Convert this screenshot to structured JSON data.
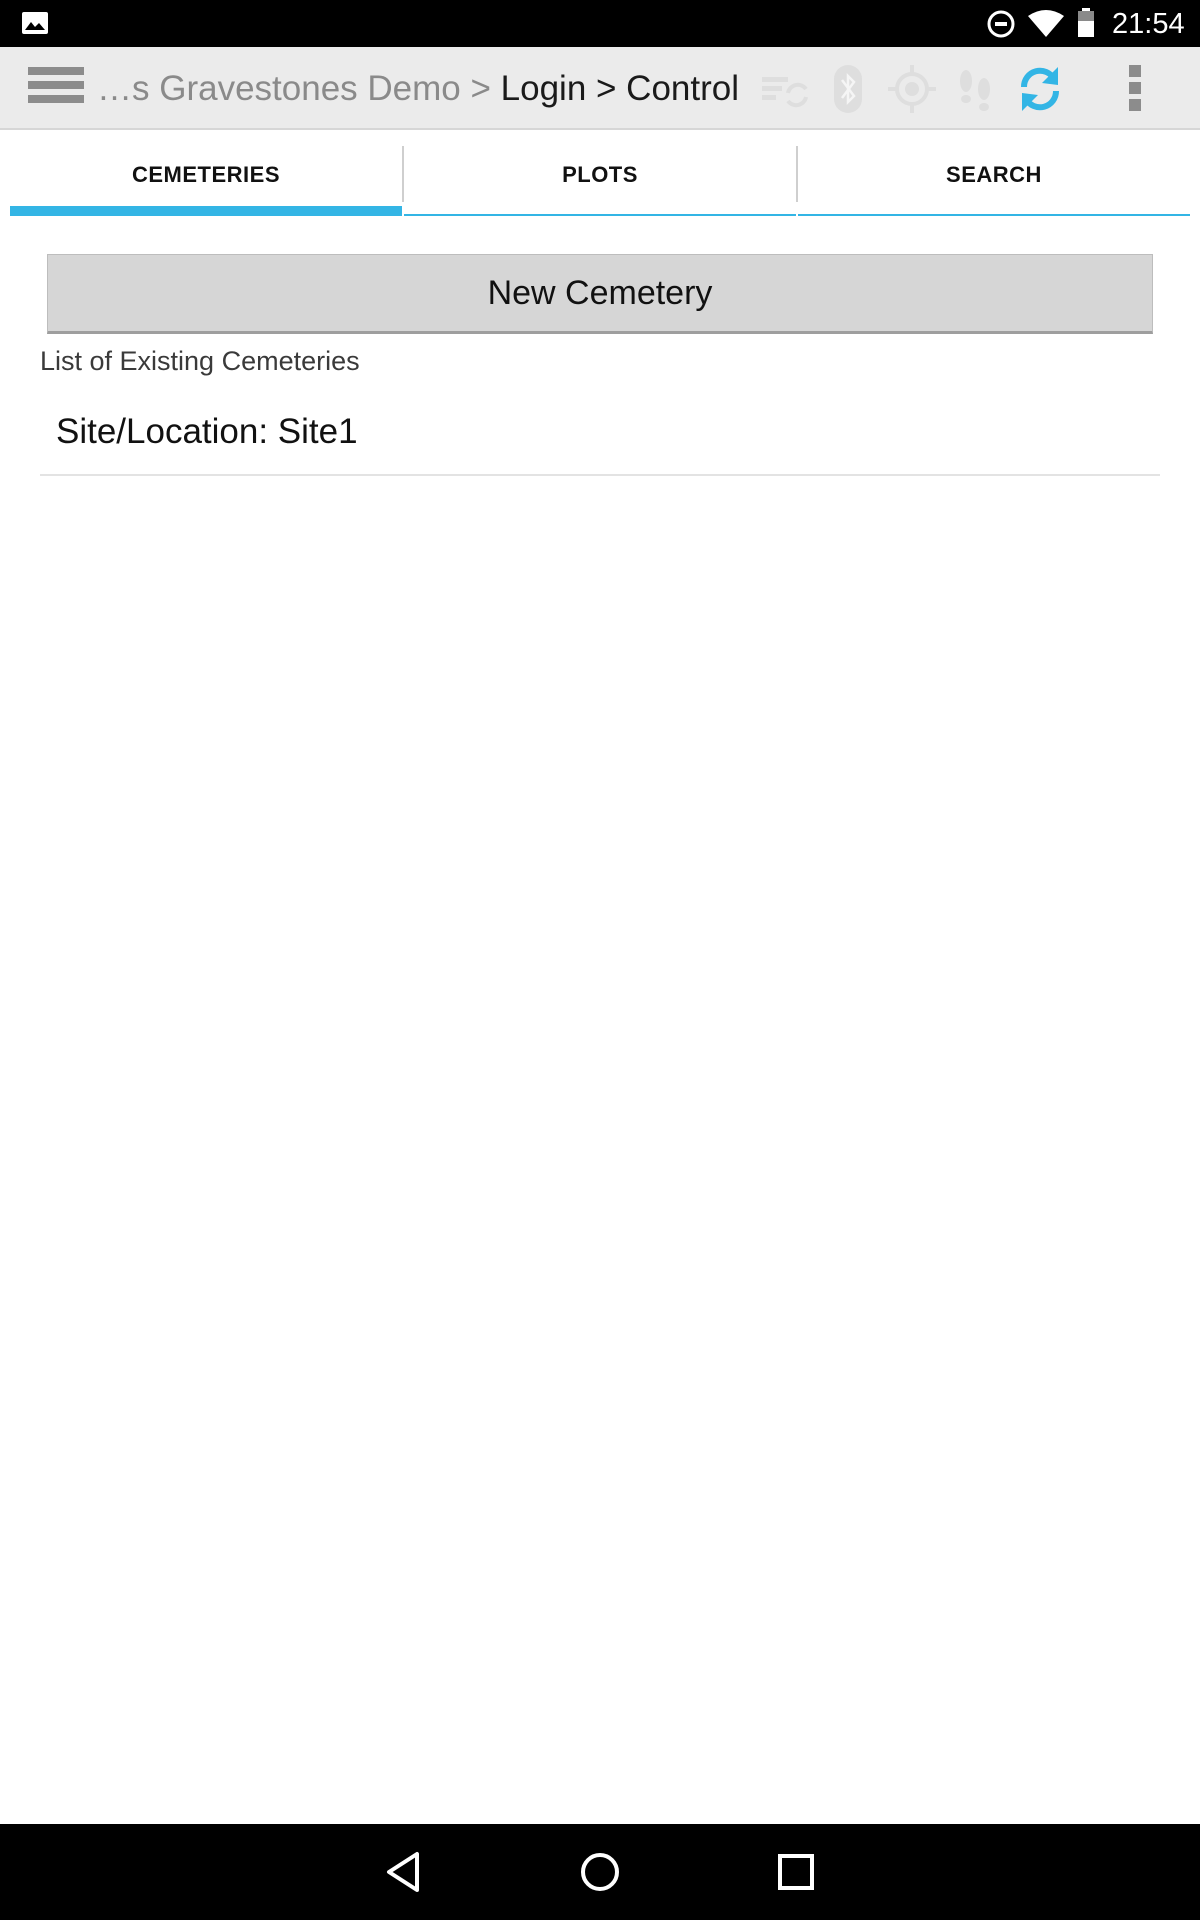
{
  "status_bar": {
    "time": "21:54",
    "icons": [
      "image-icon",
      "do-not-disturb-icon",
      "wifi-icon",
      "battery-icon"
    ]
  },
  "action_bar": {
    "breadcrumb_dim": "…s Gravestones Demo >",
    "breadcrumb_current": "Login > Control",
    "icons": [
      "sync-list-icon",
      "bluetooth-icon",
      "gps-target-icon",
      "footsteps-icon",
      "refresh-icon",
      "overflow-menu-icon"
    ],
    "accent_color": "#33b5e5"
  },
  "tabs": [
    {
      "label": "CEMETERIES",
      "active": true
    },
    {
      "label": "PLOTS",
      "active": false
    },
    {
      "label": "SEARCH",
      "active": false
    }
  ],
  "main": {
    "new_button_label": "New Cemetery",
    "list_label": "List of Existing Cemeteries",
    "items": [
      {
        "label": "Site/Location: Site1"
      }
    ]
  },
  "nav_bar": {
    "icons": [
      "back-icon",
      "home-icon",
      "recents-icon"
    ]
  }
}
